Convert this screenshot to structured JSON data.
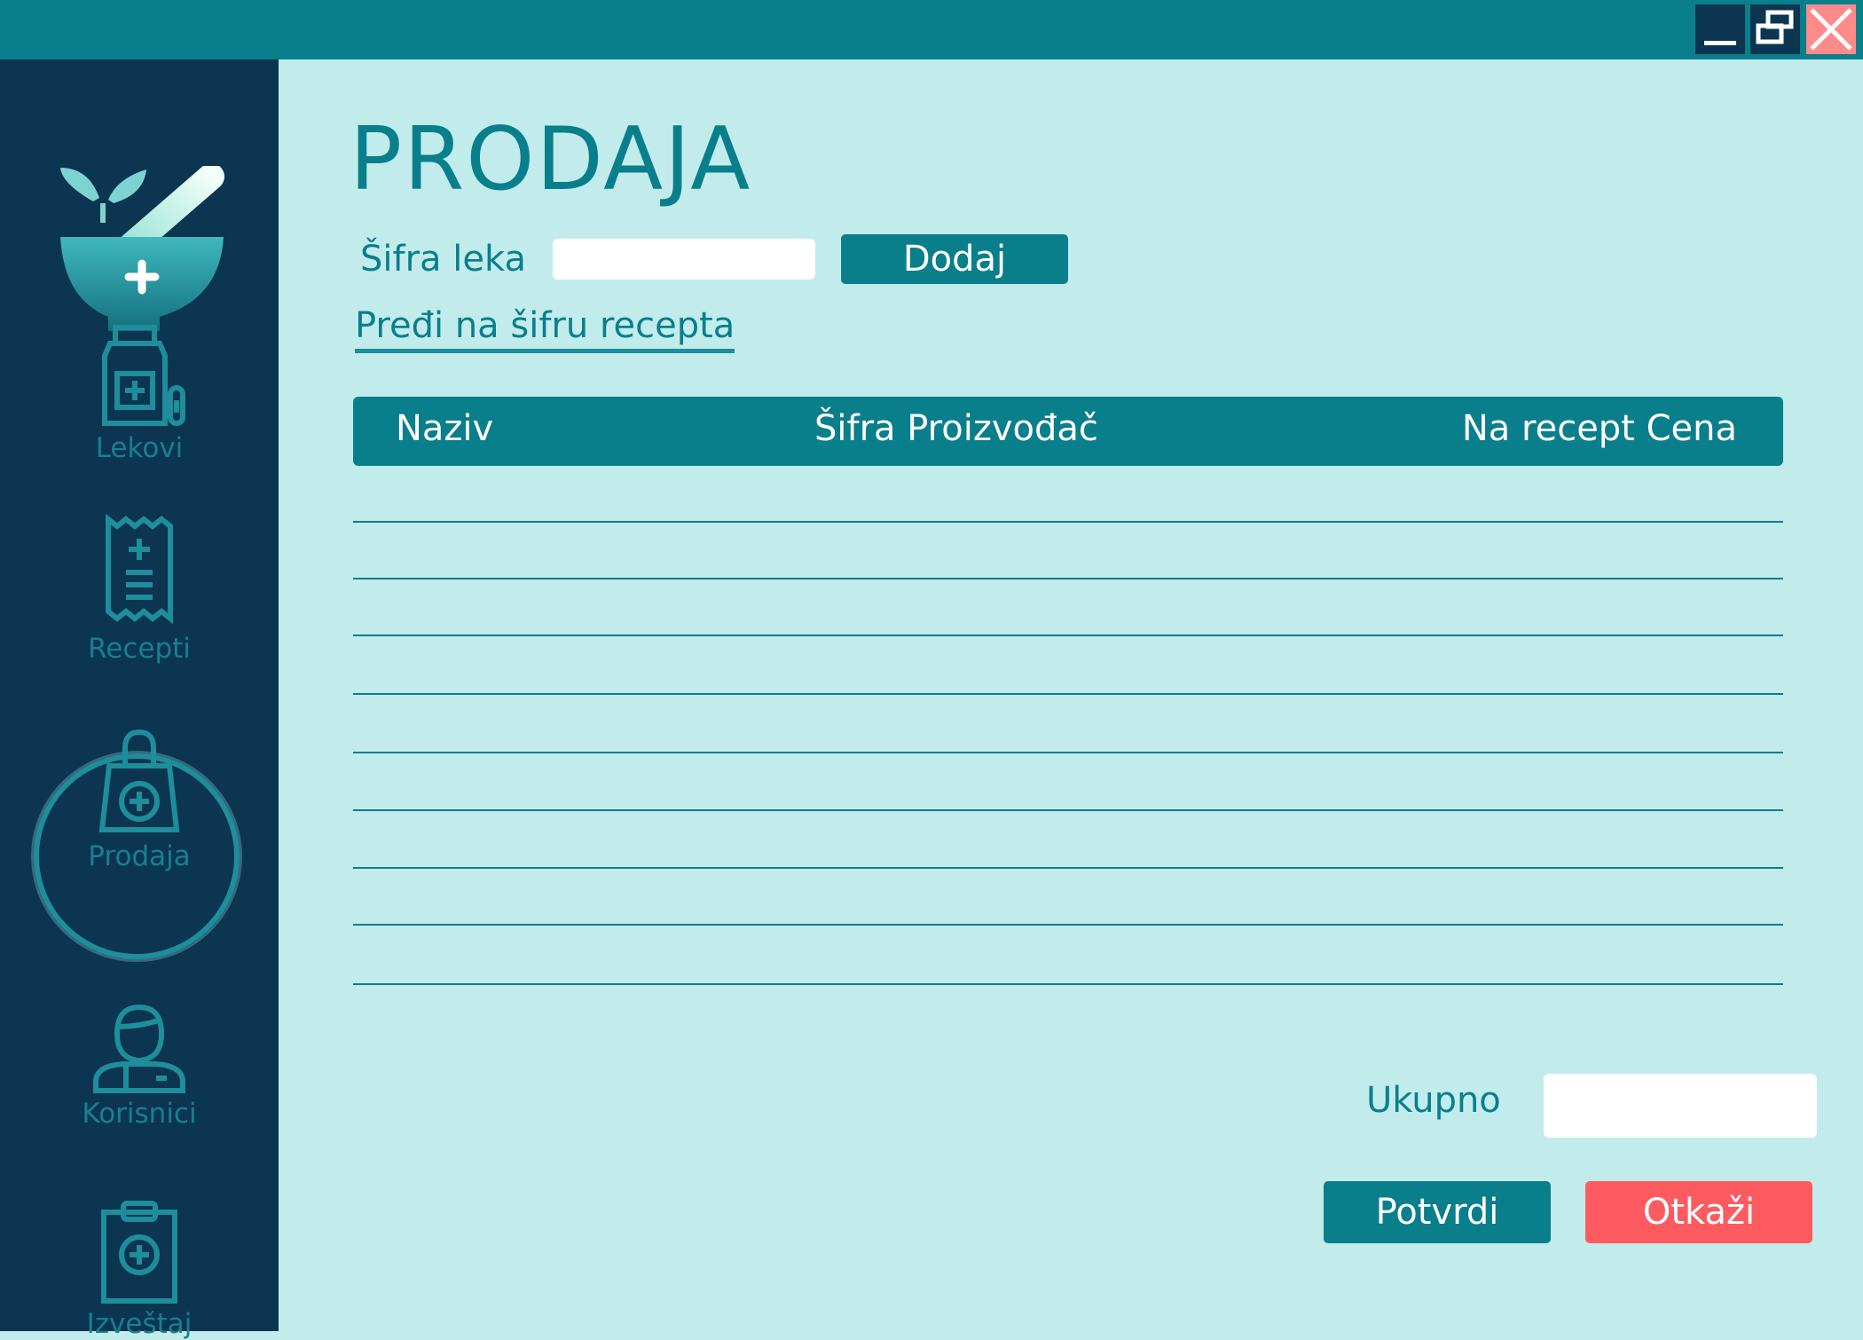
{
  "window": {
    "buttons": [
      "minimize",
      "restore",
      "close"
    ]
  },
  "sidebar": {
    "logo": "mortar-pestle-logo",
    "items": [
      {
        "label": "Lekovi",
        "icon": "medicine-bottle-icon",
        "active": false
      },
      {
        "label": "Recepti",
        "icon": "prescription-receipt-icon",
        "active": false
      },
      {
        "label": "Prodaja",
        "icon": "shopping-bag-plus-icon",
        "active": true
      },
      {
        "label": "Korisnici",
        "icon": "user-doctor-icon",
        "active": false
      },
      {
        "label": "Izveštaj",
        "icon": "clipboard-plus-icon",
        "active": false
      }
    ]
  },
  "main": {
    "title": "PRODAJA",
    "code_label": "Šifra leka",
    "code_value": "",
    "add_button": "Dodaj",
    "switch_link": "Pređi na šifru recepta",
    "table": {
      "headers": [
        "Naziv",
        "Šifra Proizvođač",
        "Na recept Cena"
      ],
      "rows": []
    },
    "total_label": "Ukupno",
    "total_value": "",
    "confirm_button": "Potvrdi",
    "cancel_button": "Otkaži"
  },
  "colors": {
    "accent": "#0a7f8c",
    "sidebar": "#0b3550",
    "background": "#c2ecec",
    "danger": "#fd5b60"
  }
}
